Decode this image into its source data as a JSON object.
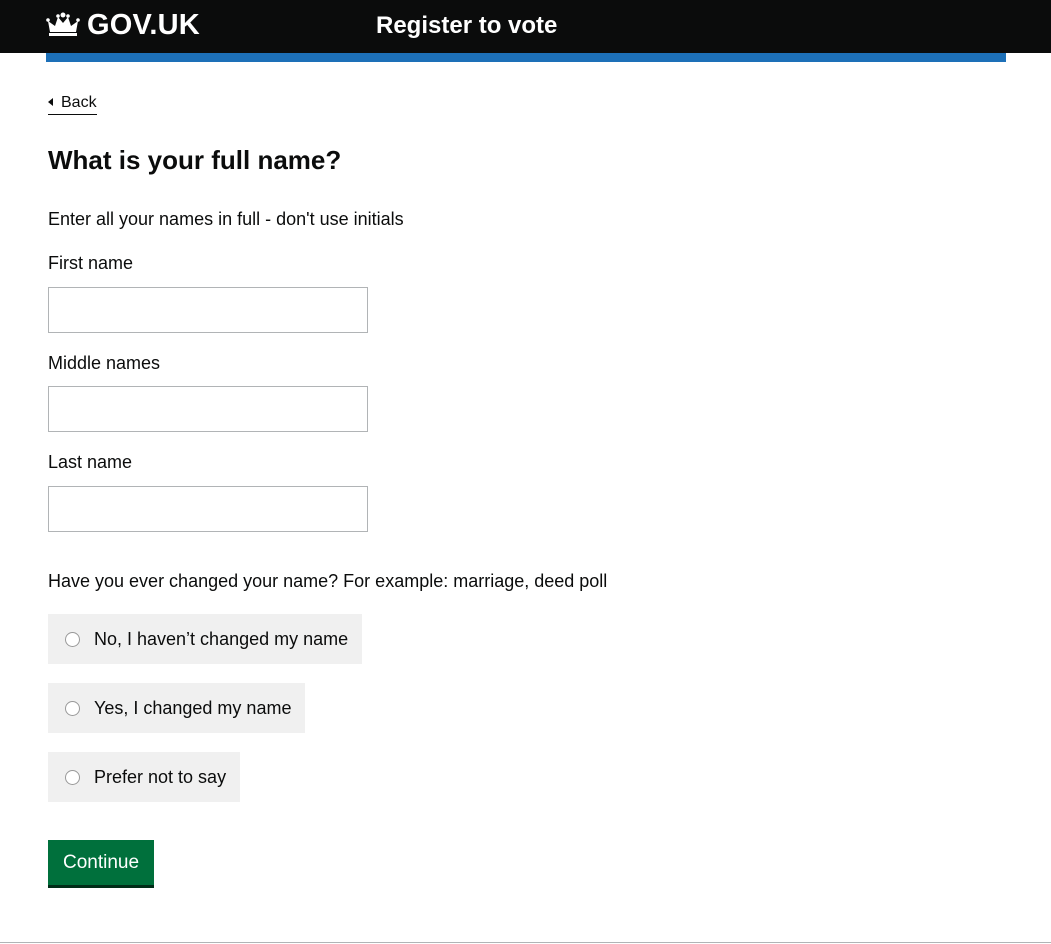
{
  "header": {
    "logo_text": "GOV.UK",
    "service_name": "Register to vote"
  },
  "back_link": "Back",
  "page_title": "What is your full name?",
  "hint": "Enter all your names in full - don't use initials",
  "fields": {
    "first_name": {
      "label": "First name",
      "value": ""
    },
    "middle_names": {
      "label": "Middle names",
      "value": ""
    },
    "last_name": {
      "label": "Last name",
      "value": ""
    }
  },
  "name_change": {
    "question": "Have you ever changed your name? For example: marriage, deed poll",
    "options": [
      {
        "label": "No, I haven’t changed my name",
        "selected": false
      },
      {
        "label": "Yes, I changed my name",
        "selected": false
      },
      {
        "label": "Prefer not to say",
        "selected": false
      }
    ]
  },
  "continue_label": "Continue",
  "colors": {
    "header_bg": "#0b0c0c",
    "accent_blue": "#1d70b8",
    "button_green": "#00703c",
    "radio_bg": "#f0f0f0"
  },
  "icons": {
    "logo": "crown-icon",
    "back": "chevron-left-icon"
  }
}
